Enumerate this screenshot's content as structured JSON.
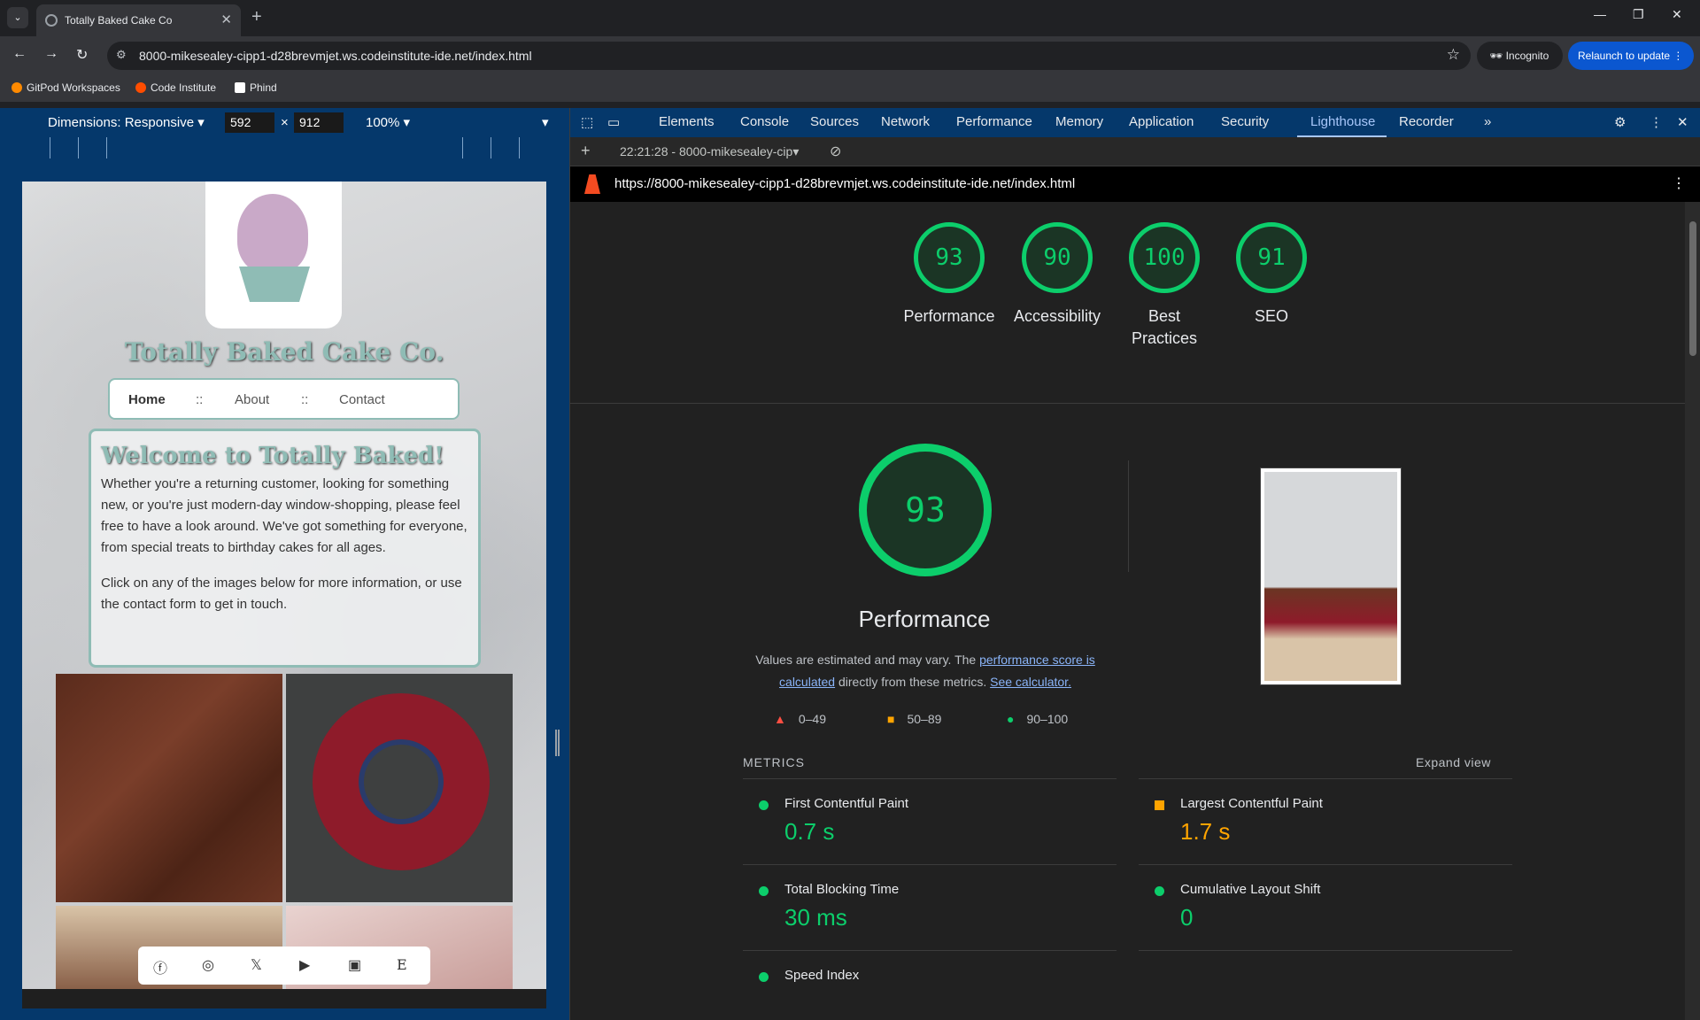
{
  "browser": {
    "tab_title": "Totally Baked Cake Co",
    "url": "8000-mikesealey-cipp1-d28brevmjet.ws.codeinstitute-ide.net/index.html",
    "incognito_label": "Incognito",
    "relaunch_label": "Relaunch to update",
    "bookmarks": [
      {
        "label": "GitPod Workspaces",
        "color": "#ff8a00"
      },
      {
        "label": "Code Institute",
        "color": "#ff4d00"
      },
      {
        "label": "Phind",
        "color": "#ffffff"
      }
    ]
  },
  "device_toolbar": {
    "dimensions_label": "Dimensions: Responsive",
    "width": "592",
    "times": "×",
    "height": "912",
    "zoom": "100%"
  },
  "site": {
    "title": "Totally Baked Cake Co.",
    "nav": [
      "Home",
      "::",
      "About",
      "::",
      "Contact"
    ],
    "welcome_heading": "Welcome to Totally Baked!",
    "welcome_p1": "Whether you're a returning customer, looking for something new, or you're just modern-day window-shopping, please feel free to have a look around. We've got something for everyone, from special treats to birthday cakes for all ages.",
    "welcome_p2": "Click on any of the images below for more information, or use the contact form to get in touch.",
    "social_icons": [
      "facebook-icon",
      "instagram-icon",
      "x-icon",
      "youtube-icon",
      "linkedin-icon",
      "etsy-icon"
    ]
  },
  "devtools": {
    "tabs": [
      "Elements",
      "Console",
      "Sources",
      "Network",
      "Performance",
      "Memory",
      "Application",
      "Security",
      "Lighthouse",
      "Recorder"
    ],
    "active_tab": "Lighthouse",
    "report_selector": "22:21:28 - 8000-mikesealey-cip",
    "report_url": "https://8000-mikesealey-cipp1-d28brevmjet.ws.codeinstitute-ide.net/index.html"
  },
  "lighthouse": {
    "scores": [
      {
        "value": "93",
        "label": "Performance"
      },
      {
        "value": "90",
        "label": "Accessibility"
      },
      {
        "value": "100",
        "label": "Best Practices"
      },
      {
        "value": "91",
        "label": "SEO"
      }
    ],
    "performance_score": "93",
    "performance_title": "Performance",
    "desc_prefix": "Values are estimated and may vary. The ",
    "desc_link1": "performance score is calculated",
    "desc_mid": " directly from these metrics. ",
    "desc_link2": "See calculator.",
    "legend": [
      {
        "range": "0–49",
        "color": "#ff4e42"
      },
      {
        "range": "50–89",
        "color": "#ffa400"
      },
      {
        "range": "90–100",
        "color": "#0cce6b"
      }
    ],
    "metrics_heading": "METRICS",
    "expand_label": "Expand view",
    "metrics": [
      {
        "name": "First Contentful Paint",
        "value": "0.7 s",
        "status": "good"
      },
      {
        "name": "Largest Contentful Paint",
        "value": "1.7 s",
        "status": "average"
      },
      {
        "name": "Total Blocking Time",
        "value": "30 ms",
        "status": "good"
      },
      {
        "name": "Cumulative Layout Shift",
        "value": "0",
        "status": "good"
      },
      {
        "name": "Speed Index",
        "value": "",
        "status": "good"
      }
    ]
  }
}
